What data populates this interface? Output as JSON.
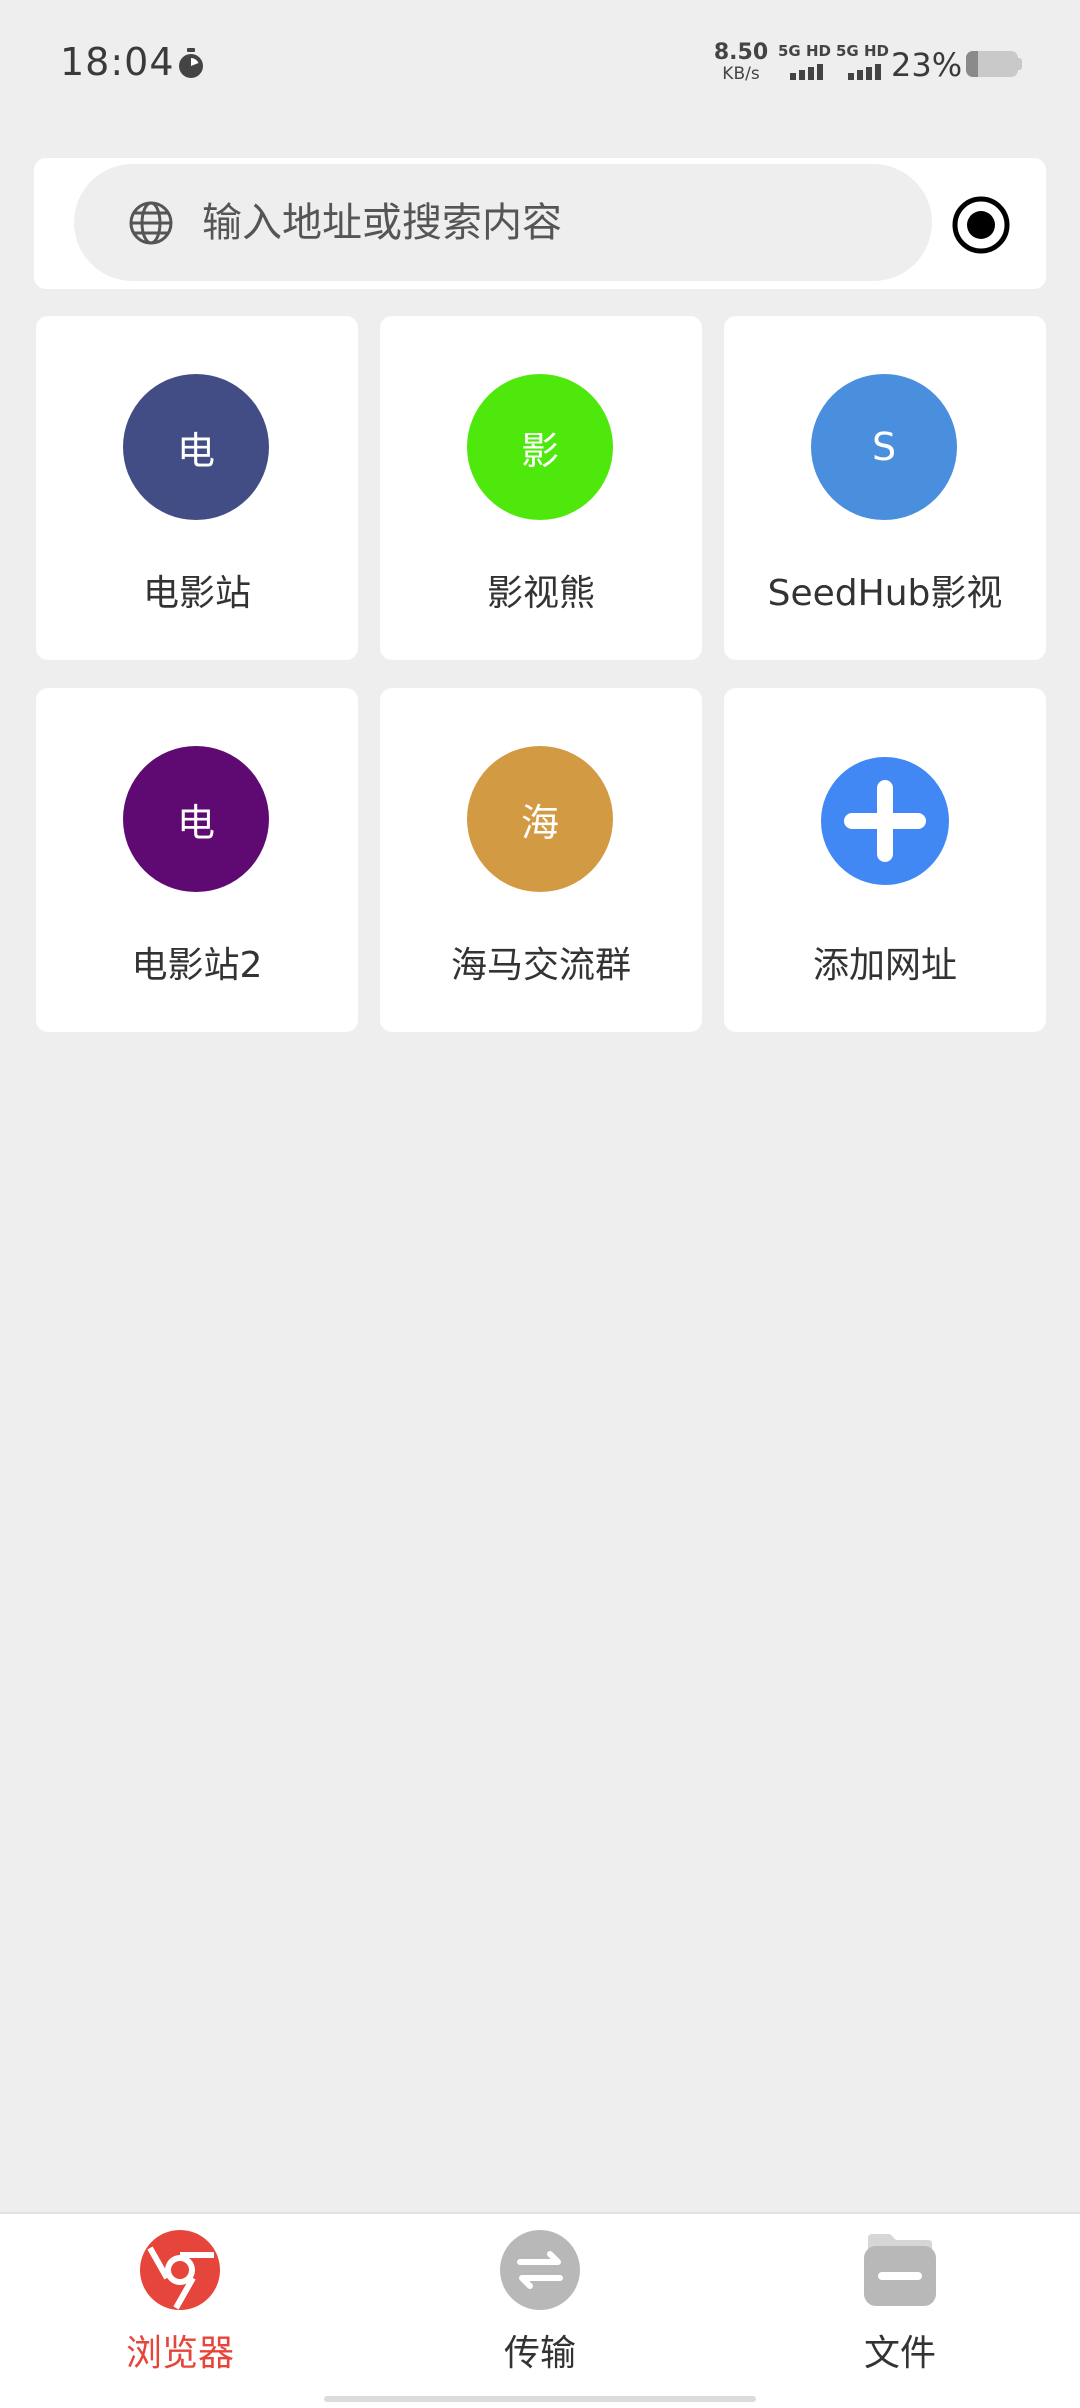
{
  "status_bar": {
    "time": "18:04",
    "net_speed_value": "8.50",
    "net_speed_unit": "KB/s",
    "sim1_label": "5G HD",
    "sim2_label": "5G HD",
    "battery_percent": "23%",
    "battery_level": 0.23
  },
  "search": {
    "placeholder": "输入地址或搜索内容",
    "value": ""
  },
  "sites": [
    {
      "letter": "电",
      "label": "电影站",
      "color": "#434d85"
    },
    {
      "letter": "影",
      "label": "影视熊",
      "color": "#4fe80c"
    },
    {
      "letter": "S",
      "label": "SeedHub影视",
      "color": "#4a8ede"
    },
    {
      "letter": "电",
      "label": "电影站2",
      "color": "#5e0a72"
    },
    {
      "letter": "海",
      "label": "海马交流群",
      "color": "#d39a44"
    },
    {
      "label": "添加网址",
      "color": "#4288f4"
    }
  ],
  "nav": {
    "browser": "浏览器",
    "transfer": "传输",
    "files": "文件",
    "active_color": "#e5453a",
    "inactive_icon_color": "#b8b8b8"
  },
  "icons": {
    "status": [
      "timer-icon",
      "signal-icon",
      "battery-icon"
    ],
    "search": [
      "globe-icon",
      "record-icon"
    ],
    "nav": [
      "browser-icon",
      "transfer-icon",
      "files-icon"
    ],
    "add": "plus-icon"
  }
}
